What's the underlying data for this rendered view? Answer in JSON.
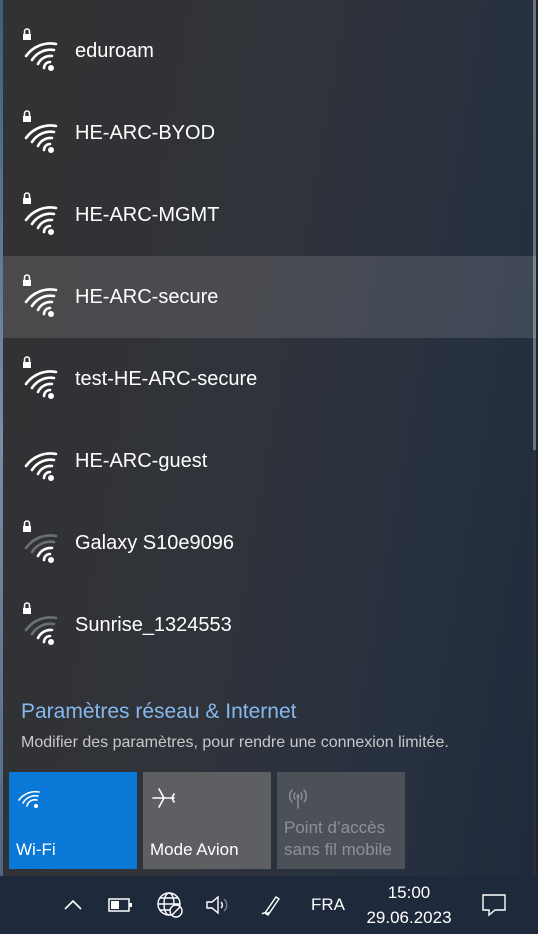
{
  "networks": [
    {
      "ssid": "eduroam",
      "secured": true,
      "signal": "full",
      "hover": false
    },
    {
      "ssid": "HE-ARC-BYOD",
      "secured": true,
      "signal": "full",
      "hover": false
    },
    {
      "ssid": "HE-ARC-MGMT",
      "secured": true,
      "signal": "full",
      "hover": false
    },
    {
      "ssid": "HE-ARC-secure",
      "secured": true,
      "signal": "full",
      "hover": true
    },
    {
      "ssid": "test-HE-ARC-secure",
      "secured": true,
      "signal": "full",
      "hover": false
    },
    {
      "ssid": "HE-ARC-guest",
      "secured": false,
      "signal": "full",
      "hover": false
    },
    {
      "ssid": "Galaxy S10e9096",
      "secured": true,
      "signal": "weak",
      "hover": false
    },
    {
      "ssid": "Sunrise_1324553",
      "secured": true,
      "signal": "weak",
      "hover": false
    }
  ],
  "settings": {
    "link": "Paramètres réseau & Internet",
    "subtitle": "Modifier des paramètres, pour rendre une connexion limitée."
  },
  "tiles": {
    "wifi": "Wi-Fi",
    "airplane": "Mode Avion",
    "hotspot_line1": "Point d’accès",
    "hotspot_line2": "sans fil mobile"
  },
  "taskbar": {
    "language": "FRA",
    "time": "15:00",
    "date": "29.06.2023"
  },
  "colors": {
    "accent": "#0a78d7",
    "link": "#86b8ec"
  },
  "icons": [
    "wifi-secured-icon",
    "wifi-open-icon",
    "wifi-weak-secured-icon",
    "airplane-icon",
    "hotspot-icon",
    "chevron-up-icon",
    "battery-icon",
    "globe-network-icon",
    "speaker-icon",
    "pen-icon",
    "notification-icon"
  ]
}
